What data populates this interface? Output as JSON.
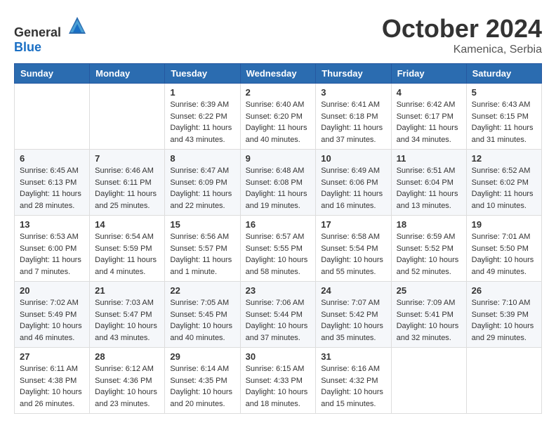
{
  "logo": {
    "text_general": "General",
    "text_blue": "Blue"
  },
  "title": "October 2024",
  "location": "Kamenica, Serbia",
  "days_of_week": [
    "Sunday",
    "Monday",
    "Tuesday",
    "Wednesday",
    "Thursday",
    "Friday",
    "Saturday"
  ],
  "weeks": [
    [
      {
        "day": "",
        "sunrise": "",
        "sunset": "",
        "daylight": ""
      },
      {
        "day": "",
        "sunrise": "",
        "sunset": "",
        "daylight": ""
      },
      {
        "day": "1",
        "sunrise": "Sunrise: 6:39 AM",
        "sunset": "Sunset: 6:22 PM",
        "daylight": "Daylight: 11 hours and 43 minutes."
      },
      {
        "day": "2",
        "sunrise": "Sunrise: 6:40 AM",
        "sunset": "Sunset: 6:20 PM",
        "daylight": "Daylight: 11 hours and 40 minutes."
      },
      {
        "day": "3",
        "sunrise": "Sunrise: 6:41 AM",
        "sunset": "Sunset: 6:18 PM",
        "daylight": "Daylight: 11 hours and 37 minutes."
      },
      {
        "day": "4",
        "sunrise": "Sunrise: 6:42 AM",
        "sunset": "Sunset: 6:17 PM",
        "daylight": "Daylight: 11 hours and 34 minutes."
      },
      {
        "day": "5",
        "sunrise": "Sunrise: 6:43 AM",
        "sunset": "Sunset: 6:15 PM",
        "daylight": "Daylight: 11 hours and 31 minutes."
      }
    ],
    [
      {
        "day": "6",
        "sunrise": "Sunrise: 6:45 AM",
        "sunset": "Sunset: 6:13 PM",
        "daylight": "Daylight: 11 hours and 28 minutes."
      },
      {
        "day": "7",
        "sunrise": "Sunrise: 6:46 AM",
        "sunset": "Sunset: 6:11 PM",
        "daylight": "Daylight: 11 hours and 25 minutes."
      },
      {
        "day": "8",
        "sunrise": "Sunrise: 6:47 AM",
        "sunset": "Sunset: 6:09 PM",
        "daylight": "Daylight: 11 hours and 22 minutes."
      },
      {
        "day": "9",
        "sunrise": "Sunrise: 6:48 AM",
        "sunset": "Sunset: 6:08 PM",
        "daylight": "Daylight: 11 hours and 19 minutes."
      },
      {
        "day": "10",
        "sunrise": "Sunrise: 6:49 AM",
        "sunset": "Sunset: 6:06 PM",
        "daylight": "Daylight: 11 hours and 16 minutes."
      },
      {
        "day": "11",
        "sunrise": "Sunrise: 6:51 AM",
        "sunset": "Sunset: 6:04 PM",
        "daylight": "Daylight: 11 hours and 13 minutes."
      },
      {
        "day": "12",
        "sunrise": "Sunrise: 6:52 AM",
        "sunset": "Sunset: 6:02 PM",
        "daylight": "Daylight: 11 hours and 10 minutes."
      }
    ],
    [
      {
        "day": "13",
        "sunrise": "Sunrise: 6:53 AM",
        "sunset": "Sunset: 6:00 PM",
        "daylight": "Daylight: 11 hours and 7 minutes."
      },
      {
        "day": "14",
        "sunrise": "Sunrise: 6:54 AM",
        "sunset": "Sunset: 5:59 PM",
        "daylight": "Daylight: 11 hours and 4 minutes."
      },
      {
        "day": "15",
        "sunrise": "Sunrise: 6:56 AM",
        "sunset": "Sunset: 5:57 PM",
        "daylight": "Daylight: 11 hours and 1 minute."
      },
      {
        "day": "16",
        "sunrise": "Sunrise: 6:57 AM",
        "sunset": "Sunset: 5:55 PM",
        "daylight": "Daylight: 10 hours and 58 minutes."
      },
      {
        "day": "17",
        "sunrise": "Sunrise: 6:58 AM",
        "sunset": "Sunset: 5:54 PM",
        "daylight": "Daylight: 10 hours and 55 minutes."
      },
      {
        "day": "18",
        "sunrise": "Sunrise: 6:59 AM",
        "sunset": "Sunset: 5:52 PM",
        "daylight": "Daylight: 10 hours and 52 minutes."
      },
      {
        "day": "19",
        "sunrise": "Sunrise: 7:01 AM",
        "sunset": "Sunset: 5:50 PM",
        "daylight": "Daylight: 10 hours and 49 minutes."
      }
    ],
    [
      {
        "day": "20",
        "sunrise": "Sunrise: 7:02 AM",
        "sunset": "Sunset: 5:49 PM",
        "daylight": "Daylight: 10 hours and 46 minutes."
      },
      {
        "day": "21",
        "sunrise": "Sunrise: 7:03 AM",
        "sunset": "Sunset: 5:47 PM",
        "daylight": "Daylight: 10 hours and 43 minutes."
      },
      {
        "day": "22",
        "sunrise": "Sunrise: 7:05 AM",
        "sunset": "Sunset: 5:45 PM",
        "daylight": "Daylight: 10 hours and 40 minutes."
      },
      {
        "day": "23",
        "sunrise": "Sunrise: 7:06 AM",
        "sunset": "Sunset: 5:44 PM",
        "daylight": "Daylight: 10 hours and 37 minutes."
      },
      {
        "day": "24",
        "sunrise": "Sunrise: 7:07 AM",
        "sunset": "Sunset: 5:42 PM",
        "daylight": "Daylight: 10 hours and 35 minutes."
      },
      {
        "day": "25",
        "sunrise": "Sunrise: 7:09 AM",
        "sunset": "Sunset: 5:41 PM",
        "daylight": "Daylight: 10 hours and 32 minutes."
      },
      {
        "day": "26",
        "sunrise": "Sunrise: 7:10 AM",
        "sunset": "Sunset: 5:39 PM",
        "daylight": "Daylight: 10 hours and 29 minutes."
      }
    ],
    [
      {
        "day": "27",
        "sunrise": "Sunrise: 6:11 AM",
        "sunset": "Sunset: 4:38 PM",
        "daylight": "Daylight: 10 hours and 26 minutes."
      },
      {
        "day": "28",
        "sunrise": "Sunrise: 6:12 AM",
        "sunset": "Sunset: 4:36 PM",
        "daylight": "Daylight: 10 hours and 23 minutes."
      },
      {
        "day": "29",
        "sunrise": "Sunrise: 6:14 AM",
        "sunset": "Sunset: 4:35 PM",
        "daylight": "Daylight: 10 hours and 20 minutes."
      },
      {
        "day": "30",
        "sunrise": "Sunrise: 6:15 AM",
        "sunset": "Sunset: 4:33 PM",
        "daylight": "Daylight: 10 hours and 18 minutes."
      },
      {
        "day": "31",
        "sunrise": "Sunrise: 6:16 AM",
        "sunset": "Sunset: 4:32 PM",
        "daylight": "Daylight: 10 hours and 15 minutes."
      },
      {
        "day": "",
        "sunrise": "",
        "sunset": "",
        "daylight": ""
      },
      {
        "day": "",
        "sunrise": "",
        "sunset": "",
        "daylight": ""
      }
    ]
  ]
}
